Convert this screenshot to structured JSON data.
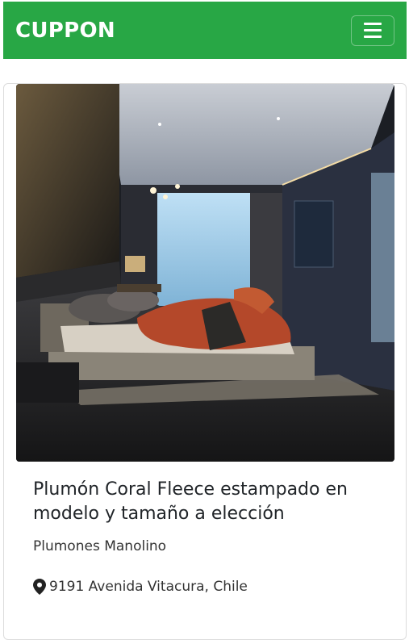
{
  "navbar": {
    "brand": "CUPPON",
    "menu_icon": "hamburger-icon",
    "color": "#28a745"
  },
  "card": {
    "image_alt": "bedroom-photo",
    "title": "Plumón Coral Fleece estampado en modelo y tamaño a elección",
    "merchant": "Plumones Manolino",
    "location_icon": "map-marker-icon",
    "address": "9191 Avenida Vitacura, Chile"
  }
}
